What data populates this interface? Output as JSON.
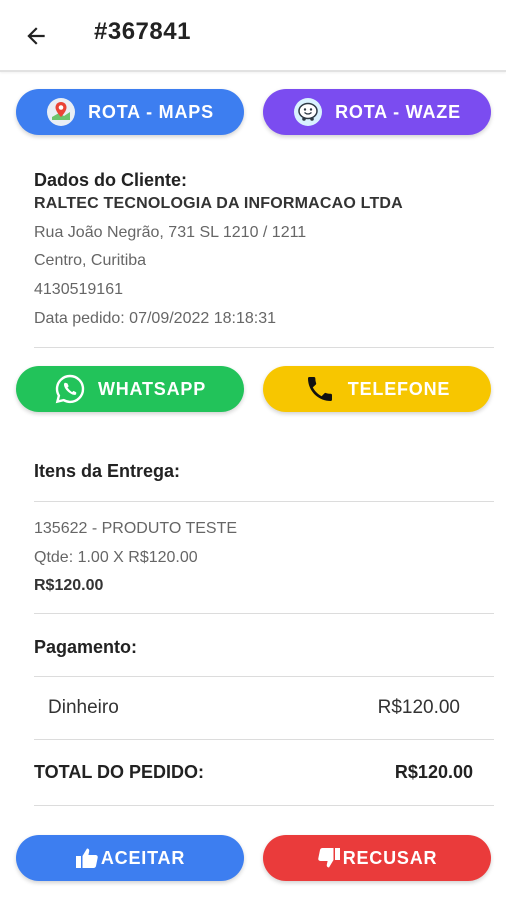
{
  "header": {
    "title": "#367841",
    "back_icon": "arrow-left-icon"
  },
  "route_buttons": {
    "maps": {
      "label": "ROTA - MAPS",
      "icon": "maps-pin-icon",
      "color": "#3d7ef0"
    },
    "waze": {
      "label": "ROTA - WAZE",
      "icon": "waze-icon",
      "color": "#7b4cf0"
    }
  },
  "client": {
    "heading": "Dados do Cliente:",
    "name": "RALTEC TECNOLOGIA DA INFORMACAO LTDA",
    "address": "Rua João Negrão, 731 SL 1210 / 1211",
    "district": "Centro, Curitiba",
    "phone": "4130519161",
    "order_date": "Data pedido: 07/09/2022 18:18:31"
  },
  "contact_buttons": {
    "whatsapp": {
      "label": "WHATSAPP",
      "icon": "whatsapp-icon",
      "color": "#22c35a"
    },
    "telefone": {
      "label": "TELEFONE",
      "icon": "phone-icon",
      "color": "#f7c600"
    }
  },
  "items": {
    "heading": "Itens da Entrega:",
    "list": [
      {
        "product": "135622 - PRODUTO TESTE",
        "qty": "Qtde: 1.00 X R$120.00",
        "subtotal": "R$120.00"
      }
    ]
  },
  "payment": {
    "heading": "Pagamento:",
    "method": "Dinheiro",
    "value": "R$120.00"
  },
  "total": {
    "label": "TOTAL DO PEDIDO:",
    "value": "R$120.00"
  },
  "actions": {
    "aceitar": {
      "label": "ACEITAR",
      "icon": "thumbs-up-icon",
      "color": "#3d7ef0"
    },
    "recusar": {
      "label": "RECUSAR",
      "icon": "thumbs-down-icon",
      "color": "#ea3b3b"
    }
  }
}
